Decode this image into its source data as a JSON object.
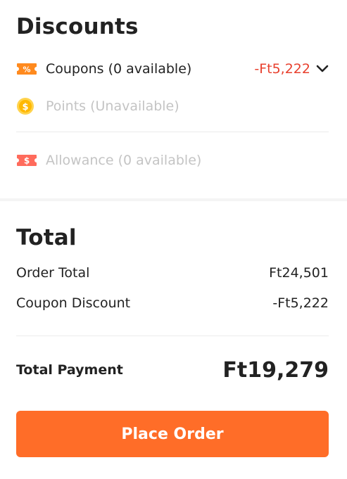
{
  "discounts": {
    "title": "Discounts",
    "coupons": {
      "label": "Coupons (0 available)",
      "value": "-Ft5,222",
      "icon": "coupon-ticket-icon",
      "icon_color": "#ff8a1e"
    },
    "points": {
      "label": "Points (Unavailable)",
      "icon": "coin-icon",
      "icon_color": "#ffd34d"
    },
    "allowance": {
      "label": "Allowance (0 available)",
      "icon": "allowance-ticket-icon",
      "icon_color": "#ff6b5c"
    }
  },
  "total": {
    "title": "Total",
    "order_total": {
      "label": "Order Total",
      "value": "Ft24,501"
    },
    "coupon_discount": {
      "label": "Coupon Discount",
      "value": "-Ft5,222"
    },
    "payment": {
      "label": "Total Payment",
      "value": "Ft19,279"
    }
  },
  "actions": {
    "place_order": "Place Order"
  },
  "colors": {
    "accent": "#ff6d28",
    "discount_red": "#e8402e",
    "disabled_text": "#c4c4c4"
  }
}
